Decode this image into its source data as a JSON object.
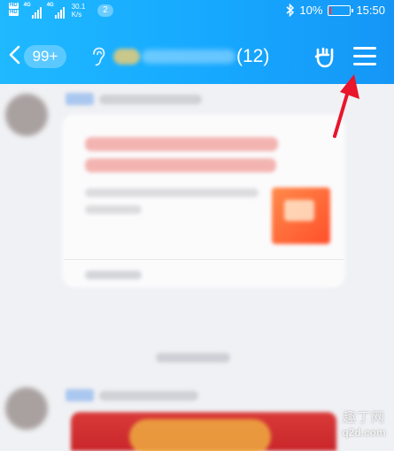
{
  "status_bar": {
    "hd_tag": "HD",
    "network_label": "4G",
    "speed_value": "30.1",
    "speed_unit": "K/s",
    "notification_count": "2",
    "battery_percent": "10%",
    "battery_level": 0.1,
    "time": "15:50"
  },
  "nav": {
    "unread_count": "99+",
    "member_count": "(12)"
  },
  "colors": {
    "header_start": "#1fb9ff",
    "header_end": "#1596f6",
    "annotation_arrow": "#e8152b",
    "battery_low": "#ff3b3b"
  },
  "icons": {
    "back": "chevron-left-icon",
    "voice": "ear-icon",
    "gesture": "rock-hand-icon",
    "menu": "hamburger-menu-icon",
    "bluetooth": "bluetooth-icon"
  },
  "watermark": {
    "line1": "趣丁网",
    "line2": "q2d.com"
  }
}
